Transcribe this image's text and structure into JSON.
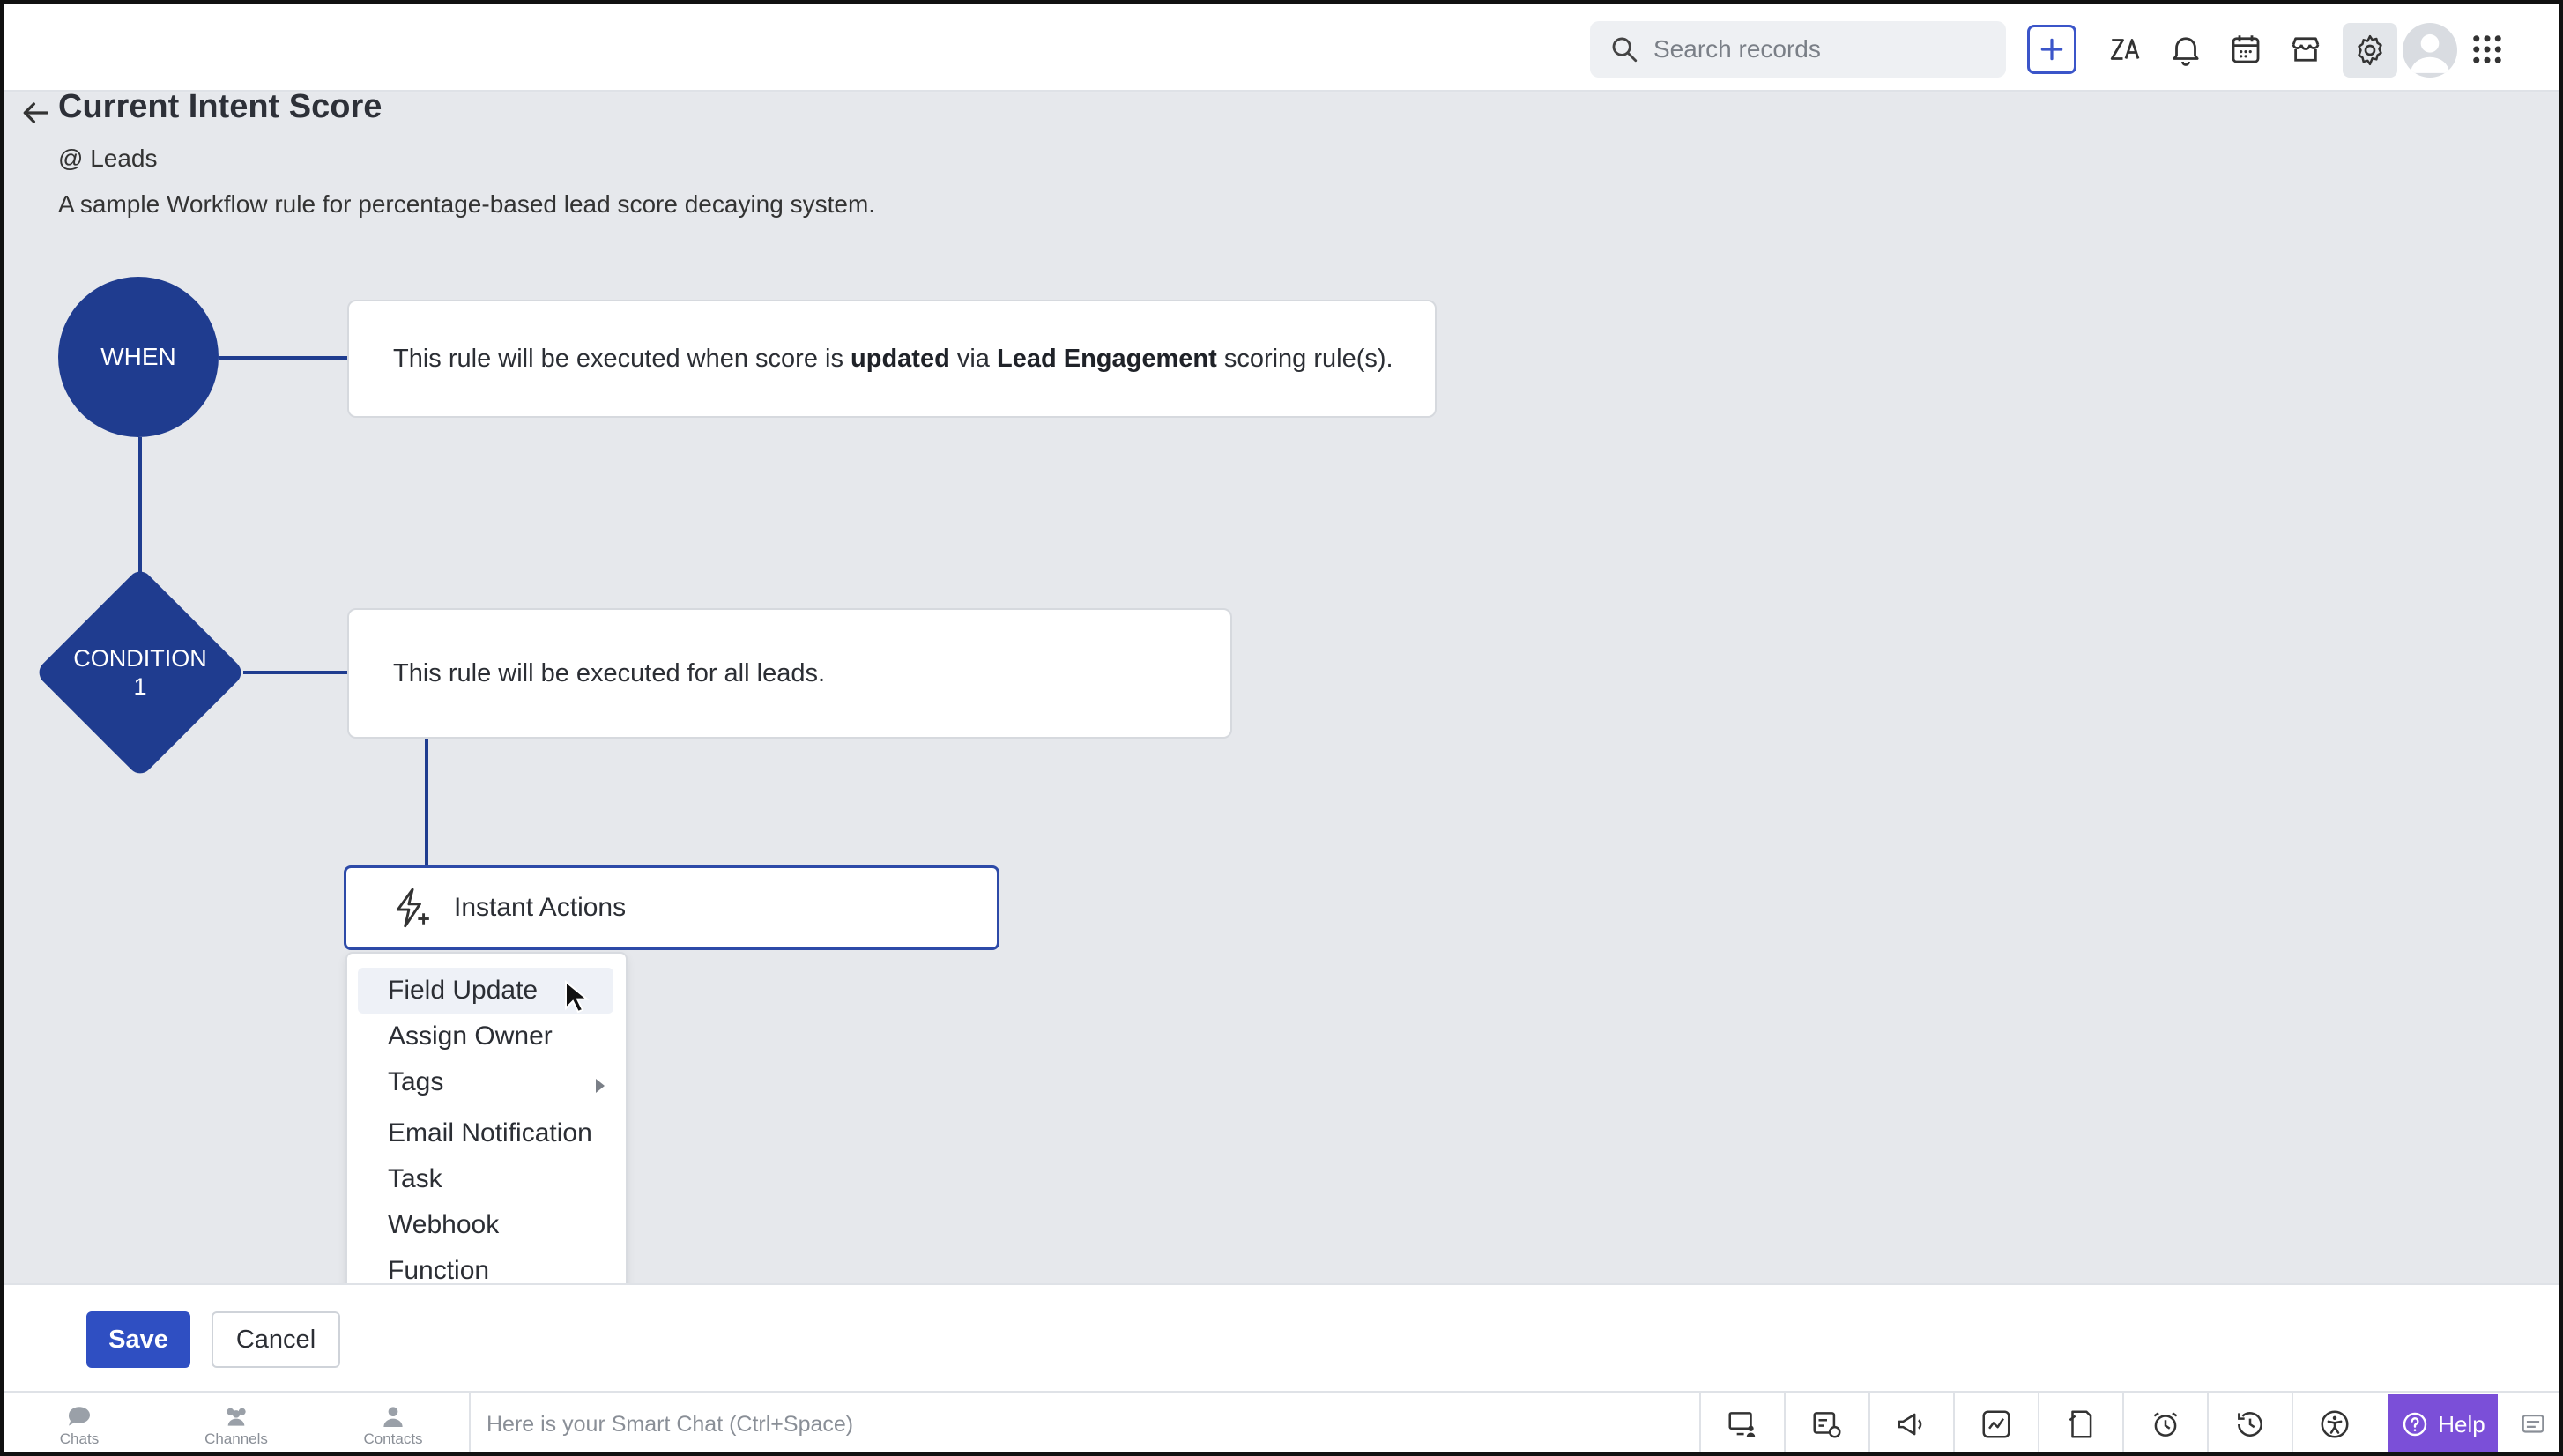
{
  "header": {
    "search_placeholder": "Search records",
    "icons": [
      "search-icon",
      "plus-icon",
      "translate-icon",
      "bell-icon",
      "calendar-icon",
      "marketplace-icon",
      "gear-icon",
      "avatar",
      "apps-grid-icon"
    ]
  },
  "page": {
    "title": "Current Intent Score",
    "module": "@ Leads",
    "description": "A sample Workflow rule for percentage-based lead score decaying system."
  },
  "flow": {
    "when_label": "WHEN",
    "when_text_prefix": "This rule will be executed when score is ",
    "when_text_bold1": "updated",
    "when_text_mid": " via ",
    "when_text_bold2": "Lead Engagement",
    "when_text_suffix": " scoring rule(s).",
    "condition_label_line1": "CONDITION",
    "condition_label_line2": "1",
    "condition_text": "This rule will be executed for all leads.",
    "actions_label": "Instant Actions"
  },
  "action_menu": {
    "items": [
      {
        "label": "Field Update"
      },
      {
        "label": "Assign Owner"
      },
      {
        "label": "Tags"
      },
      {
        "label": "Email Notification"
      },
      {
        "label": "Task"
      },
      {
        "label": "Webhook"
      },
      {
        "label": "Function"
      }
    ]
  },
  "buttons": {
    "save": "Save",
    "cancel": "Cancel"
  },
  "footer": {
    "tabs": [
      {
        "label": "Chats"
      },
      {
        "label": "Channels"
      },
      {
        "label": "Contacts"
      }
    ],
    "smart_chat_placeholder": "Here is your Smart Chat (Ctrl+Space)",
    "help_label": "Help"
  },
  "colors": {
    "accent": "#1f3c8f",
    "primary_button": "#2f4fc2",
    "help_button": "#7b4fd8"
  }
}
